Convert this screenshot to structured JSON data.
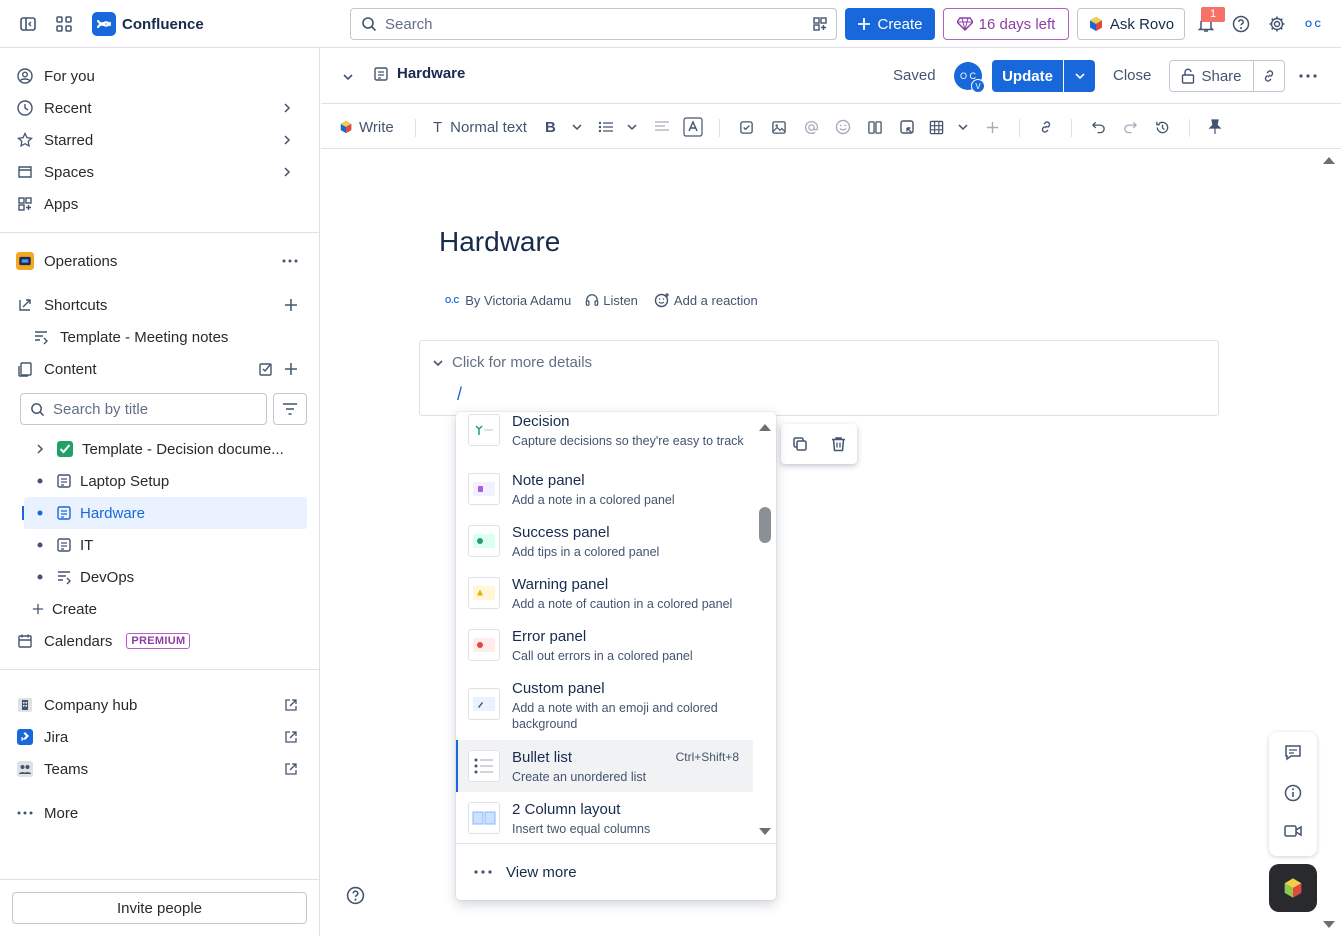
{
  "topbar": {
    "app_name": "Confluence",
    "search_placeholder": "Search",
    "create_label": "Create",
    "trial_label": "16 days left",
    "rovo_label": "Ask Rovo",
    "notification_count": "1",
    "profile_initials": "O C"
  },
  "sidebar": {
    "nav": [
      "For you",
      "Recent",
      "Starred",
      "Spaces",
      "Apps"
    ],
    "space_name": "Operations",
    "shortcuts_label": "Shortcuts",
    "shortcut_item": "Template - Meeting notes",
    "content_label": "Content",
    "search_placeholder": "Search by title",
    "tree": [
      {
        "label": "Template - Decision docume..."
      },
      {
        "label": "Laptop Setup"
      },
      {
        "label": "Hardware"
      },
      {
        "label": "IT"
      },
      {
        "label": "DevOps"
      }
    ],
    "create_label": "Create",
    "calendars_label": "Calendars",
    "premium_badge": "PREMIUM",
    "apps": [
      "Company hub",
      "Jira",
      "Teams"
    ],
    "more_label": "More",
    "invite_label": "Invite people"
  },
  "page_header": {
    "title": "Hardware",
    "saved_label": "Saved",
    "avatar_initials": "O C",
    "avatar_badge": "V",
    "update_label": "Update",
    "close_label": "Close",
    "share_label": "Share"
  },
  "toolbar": {
    "write_label": "Write",
    "text_style": "Normal text"
  },
  "document": {
    "title": "Hardware",
    "author_initials": "O.C",
    "byline": "By Victoria Adamu",
    "listen_label": "Listen",
    "reaction_label": "Add a reaction",
    "expand_label": "Click for more details",
    "slash": "/"
  },
  "slash_menu": {
    "items": [
      {
        "title": "Decision",
        "desc": "Capture decisions so they're easy to track"
      },
      {
        "title": "Note panel",
        "desc": "Add a note in a colored panel"
      },
      {
        "title": "Success panel",
        "desc": "Add tips in a colored panel"
      },
      {
        "title": "Warning panel",
        "desc": "Add a note of caution in a colored panel"
      },
      {
        "title": "Error panel",
        "desc": "Call out errors in a colored panel"
      },
      {
        "title": "Custom panel",
        "desc": "Add a note with an emoji and colored background"
      },
      {
        "title": "Bullet list",
        "desc": "Create an unordered list",
        "shortcut": "Ctrl+Shift+8"
      },
      {
        "title": "2 Column layout",
        "desc": "Insert two equal columns"
      }
    ],
    "view_more_label": "View more"
  },
  "colors": {
    "accent": "#1868db",
    "premium": "#8f3ea6",
    "selected_bg": "#e9f2fe"
  }
}
